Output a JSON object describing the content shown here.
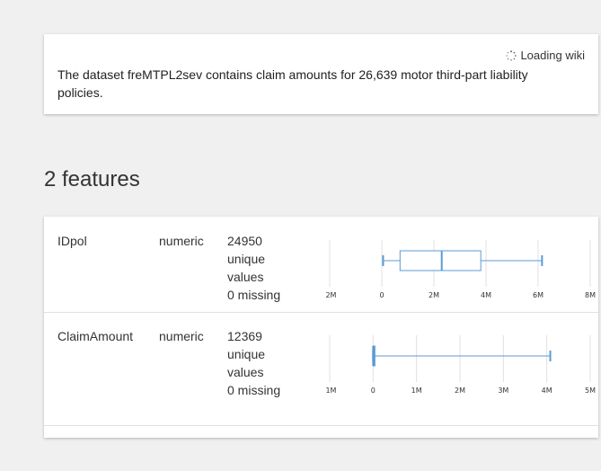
{
  "header_card": {
    "loading_text": "Loading wiki",
    "description": "The dataset freMTPL2sev contains claim amounts for 26,639 motor third-part liability policies."
  },
  "features_title": "2 features",
  "colors": {
    "box": "#5b9bd5",
    "grid": "#e0e0e0",
    "text": "#212121"
  },
  "features": [
    {
      "name": "IDpol",
      "type": "numeric",
      "unique_count": "24950",
      "unique_line1": "unique",
      "unique_line2": "values",
      "missing": "0 missing",
      "boxplot": {
        "ticks": [
          "-2M",
          "0",
          "2M",
          "4M",
          "6M",
          "8M"
        ],
        "tick_values": [
          -2,
          0,
          2,
          4,
          6,
          8
        ],
        "xmin": -2,
        "xmax": 8,
        "whisker_low": 0.05,
        "q1": 0.7,
        "median": 2.3,
        "q3": 3.8,
        "whisker_high": 6.15
      }
    },
    {
      "name": "ClaimAmount",
      "type": "numeric",
      "unique_count": "12369",
      "unique_line1": "unique",
      "unique_line2": "values",
      "missing": "0 missing",
      "boxplot": {
        "ticks": [
          "-1M",
          "0",
          "1M",
          "2M",
          "3M",
          "4M",
          "5M"
        ],
        "tick_values": [
          -1,
          0,
          1,
          2,
          3,
          4,
          5
        ],
        "xmin": -1,
        "xmax": 5,
        "whisker_low": 0.0,
        "q1": 0.0,
        "median": 0.0,
        "q3": 0.04,
        "whisker_high": 4.08
      }
    }
  ]
}
